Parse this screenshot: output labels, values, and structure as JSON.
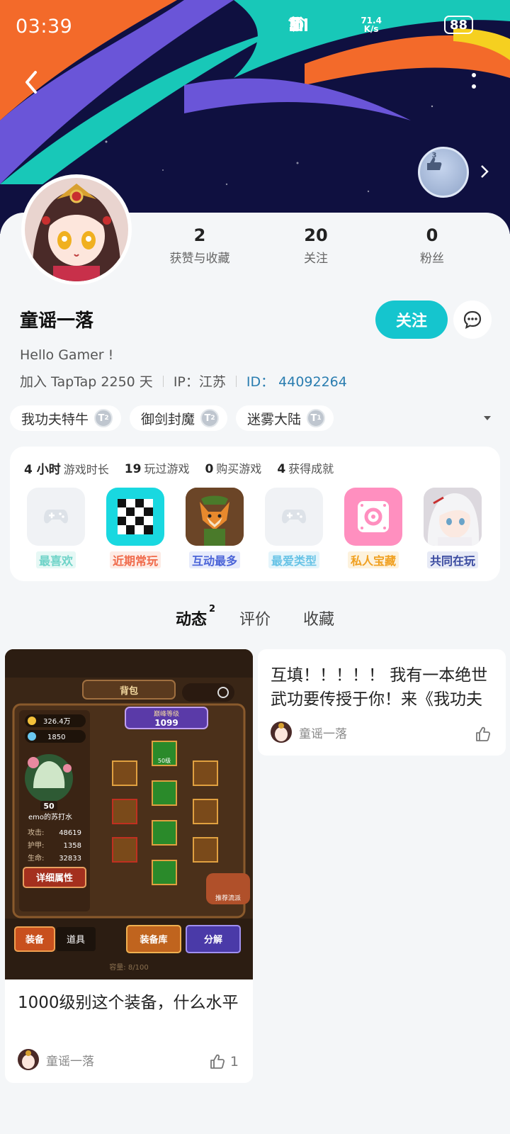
{
  "status_bar": {
    "time": "03:39",
    "net_speed_value": "71.4",
    "net_speed_unit": "K/s",
    "signal_label": "4G",
    "battery": "88"
  },
  "profile": {
    "username": "童谣一落",
    "bio": "Hello Gamer !",
    "joined": "加入 TapTap 2250 天",
    "ip": "IP：江苏",
    "id_label": "ID：",
    "id_value": "44092264",
    "follow_label": "关注",
    "medal_level": "3"
  },
  "stats": [
    {
      "value": "2",
      "label": "获赞与收藏"
    },
    {
      "value": "20",
      "label": "关注"
    },
    {
      "value": "0",
      "label": "粉丝"
    }
  ],
  "tags": [
    {
      "name": "我功夫特牛",
      "level": "2"
    },
    {
      "name": "御剑封魔",
      "level": "2"
    },
    {
      "name": "迷雾大陆",
      "level": "1"
    }
  ],
  "game_stats": [
    {
      "value": "4 小时",
      "label": "游戏时长"
    },
    {
      "value": "19",
      "label": "玩过游戏"
    },
    {
      "value": "0",
      "label": "购买游戏"
    },
    {
      "value": "4",
      "label": "获得成就"
    }
  ],
  "game_icons": [
    {
      "label": "最喜欢",
      "color": "#6ed3c8",
      "bg": "#e6f8f5"
    },
    {
      "label": "近期常玩",
      "color": "#f06a4a",
      "bg": "#fdebe5"
    },
    {
      "label": "互动最多",
      "color": "#4b64d8",
      "bg": "#e7ebfb"
    },
    {
      "label": "最爱类型",
      "color": "#67c3e6",
      "bg": "#e5f5fb"
    },
    {
      "label": "私人宝藏",
      "color": "#f0a020",
      "bg": "#fdf2dd"
    },
    {
      "label": "共同在玩",
      "color": "#3a4aa0",
      "bg": "#e7eaf6"
    }
  ],
  "tabs": {
    "posts": "动态",
    "posts_count": "2",
    "reviews": "评价",
    "favorites": "收藏"
  },
  "posts": [
    {
      "title": "1000级别这个装备，什么水平",
      "author": "童谣一落",
      "likes": "1",
      "game_screen": {
        "header": "背包",
        "peak_level_label": "巅峰等级",
        "peak_level": "1099",
        "gold": "326.4万",
        "gems": "1850",
        "char_level": "50",
        "char_name": "emo的苏打水",
        "attack_label": "攻击:",
        "attack": "48619",
        "armor_label": "护甲:",
        "armor": "1358",
        "hp_label": "生命:",
        "hp": "32833",
        "detail_btn": "详细属性",
        "equip_btn": "装备",
        "items_btn": "道具",
        "storage_btn": "装备库",
        "decompose_btn": "分解",
        "recommend": "推荐流派",
        "capacity": "容量: 8/100",
        "slot_level": "50级"
      }
    },
    {
      "text": "互填！！！！！ 我有一本绝世武功要传授于你！来《我功夫",
      "author": "童谣一落"
    }
  ]
}
